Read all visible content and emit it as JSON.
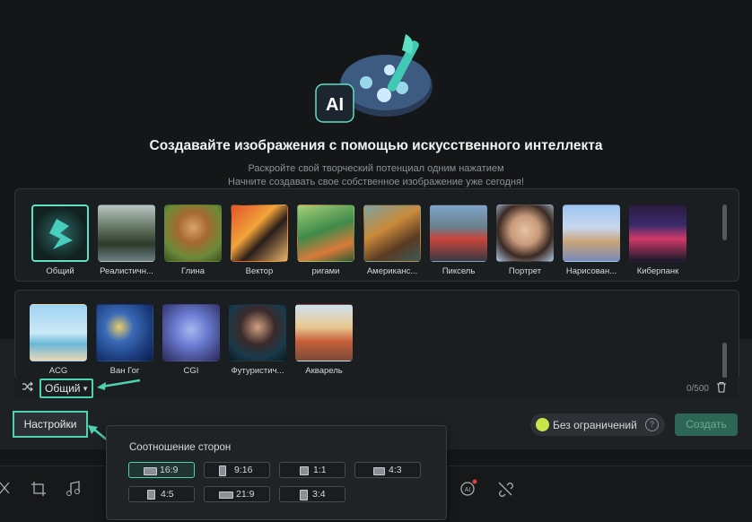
{
  "hero": {
    "logo_text": "AI",
    "title": "Создавайте изображения с помощью искусственного интеллекта",
    "subtitle_line1": "Раскройте свой творческий потенциал одним нажатием",
    "subtitle_line2": "Начните создавать свое собственное изображение уже сегодня!"
  },
  "styles_row1": [
    {
      "label": "Общий",
      "selected": true
    },
    {
      "label": "Реалистичн..."
    },
    {
      "label": "Глина"
    },
    {
      "label": "Вектор"
    },
    {
      "label": "ригами"
    },
    {
      "label": "Американс..."
    },
    {
      "label": "Пиксель"
    },
    {
      "label": "Портрет"
    },
    {
      "label": "Нарисован..."
    },
    {
      "label": "Киберпанк"
    }
  ],
  "styles_row2": [
    {
      "label": "ACG"
    },
    {
      "label": "Ван Гог"
    },
    {
      "label": "CGI"
    },
    {
      "label": "Футуристич..."
    },
    {
      "label": "Акварель"
    }
  ],
  "prompt": {
    "style_value": "Общий",
    "counter": "0/500"
  },
  "actions": {
    "settings_label": "Настройки",
    "unlimited_label": "Без ограничений",
    "help_glyph": "?",
    "create_label": "Создать"
  },
  "aspect_popup": {
    "title": "Соотношение сторон",
    "options": [
      {
        "label": "16:9",
        "active": true
      },
      {
        "label": "9:16"
      },
      {
        "label": "1:1"
      },
      {
        "label": "4:3"
      },
      {
        "label": "4:5"
      },
      {
        "label": "21:9"
      },
      {
        "label": "3:4"
      }
    ]
  },
  "toolbar_icons": [
    "scissors-icon",
    "crop-icon",
    "music-icon",
    "ai-sticker-icon",
    "unlink-icon"
  ]
}
